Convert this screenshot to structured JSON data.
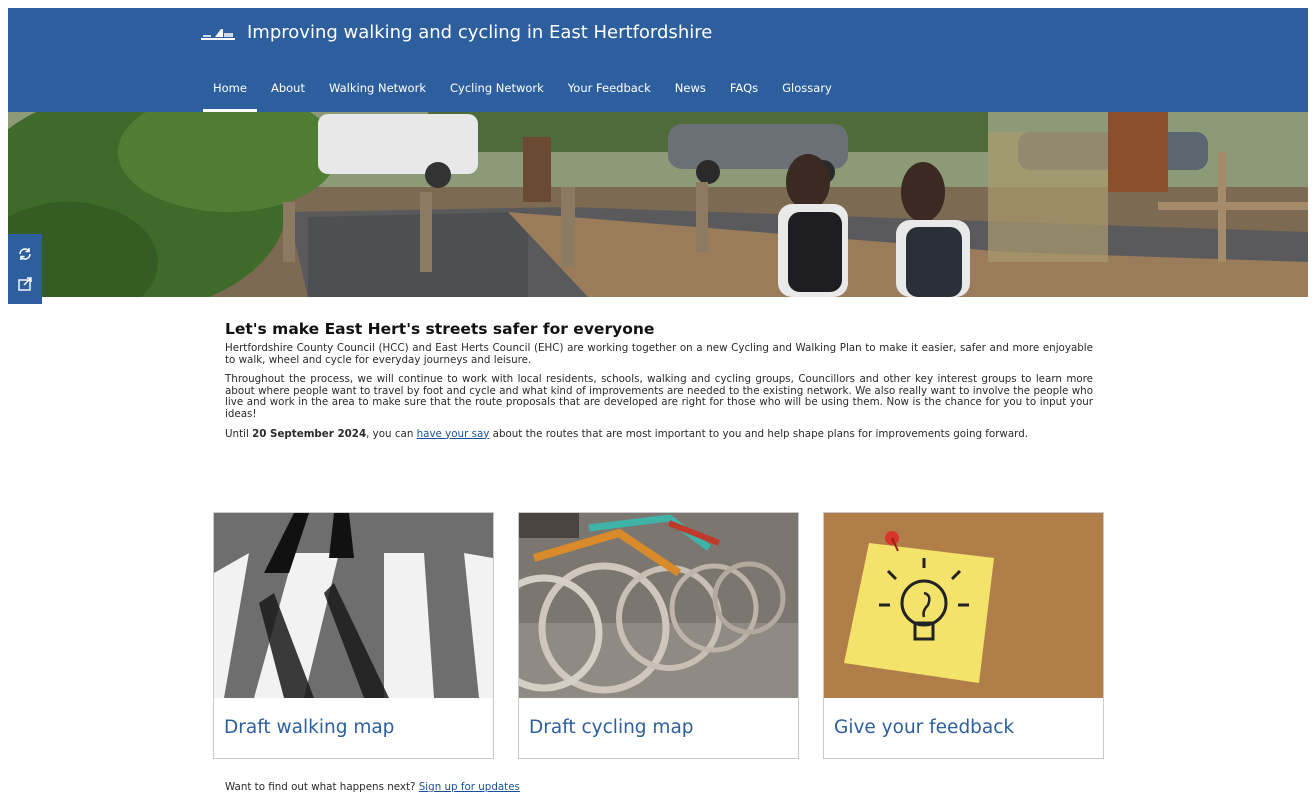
{
  "header": {
    "title": "Improving walking and cycling in East Hertfordshire",
    "logo_icon": "council-logo-icon"
  },
  "nav": {
    "items": [
      {
        "label": "Home",
        "active": true
      },
      {
        "label": "About"
      },
      {
        "label": "Walking Network"
      },
      {
        "label": "Cycling Network"
      },
      {
        "label": "Your Feedback"
      },
      {
        "label": "News"
      },
      {
        "label": "FAQs"
      },
      {
        "label": "Glossary"
      }
    ]
  },
  "side_tools": [
    {
      "icon": "refresh-icon"
    },
    {
      "icon": "share-icon"
    }
  ],
  "intro": {
    "heading": "Let's make East Hert's streets safer for everyone",
    "p1": "Hertfordshire County Council (HCC) and East Herts Council (EHC) are working together on a new Cycling and Walking Plan to make it easier, safer and more enjoyable to walk, wheel and cycle for everyday journeys and leisure.",
    "p2": "Throughout the process, we will continue to work with local residents, schools, walking and cycling groups, Councillors and other key interest groups to learn more about where people want to travel by foot and cycle and what kind of improvements are needed to the existing network. We also really want to involve the people who live and work in the area to make sure that the route proposals that are developed are right for those who will be using them. Now is the chance for you to input your ideas!",
    "p3_prefix": "Until ",
    "p3_date": "20 September 2024",
    "p3_mid": ", you can ",
    "p3_link": "have your say",
    "p3_suffix": " about the routes that are most important to you and help shape plans for improvements going forward."
  },
  "cards": [
    {
      "label": "Draft walking map"
    },
    {
      "label": "Draft cycling map"
    },
    {
      "label": "Give your feedback"
    }
  ],
  "footer": {
    "text": "Want to find out what happens next? ",
    "link": "Sign up for updates"
  },
  "colors": {
    "brand_blue": "#2d5f9e",
    "link_blue": "#1a4f9c"
  }
}
